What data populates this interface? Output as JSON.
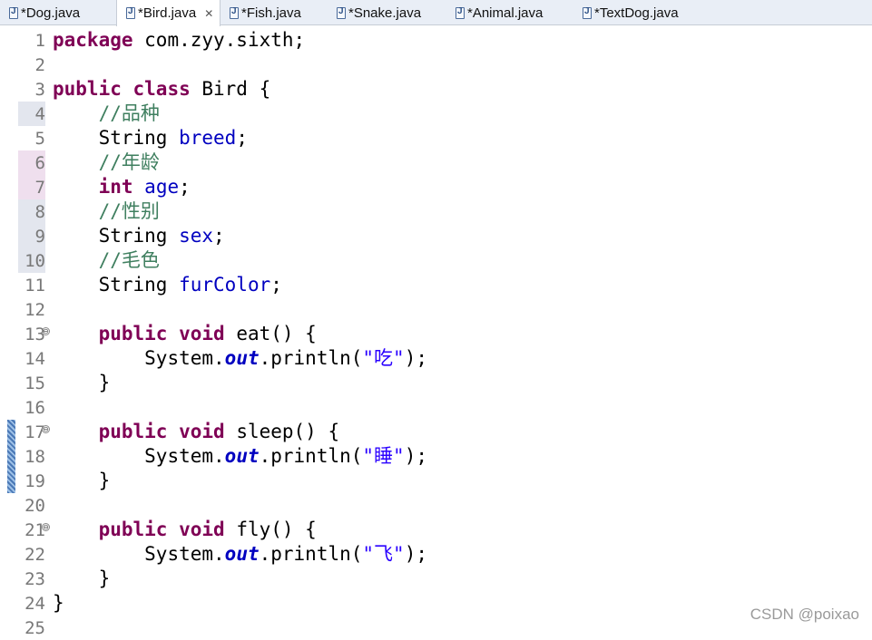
{
  "tabs": [
    {
      "label": "*Dog.java",
      "active": false
    },
    {
      "label": "*Bird.java",
      "active": true
    },
    {
      "label": "*Fish.java",
      "active": false
    },
    {
      "label": "*Snake.java",
      "active": false
    },
    {
      "label": "*Animal.java",
      "active": false
    },
    {
      "label": "*TextDog.java",
      "active": false
    }
  ],
  "close_glyph": "✕",
  "line_numbers": [
    "1",
    "2",
    "3",
    "4",
    "5",
    "6",
    "7",
    "8",
    "9",
    "10",
    "11",
    "12",
    "13",
    "14",
    "15",
    "16",
    "17",
    "18",
    "19",
    "20",
    "21",
    "22",
    "23",
    "24",
    "25"
  ],
  "fold_glyph": "⊖",
  "code": {
    "l1": {
      "kw": "package",
      "rest": " com.zyy.sixth;"
    },
    "l3": {
      "kw1": "public",
      "kw2": "class",
      "rest": " Bird {"
    },
    "l4": {
      "comment": "//品种"
    },
    "l5": {
      "type": "String",
      "field": "breed",
      "end": ";"
    },
    "l6": {
      "comment": "//年龄"
    },
    "l7": {
      "kw": "int",
      "field": "age",
      "end": ";"
    },
    "l8": {
      "comment": "//性别"
    },
    "l9": {
      "type": "String",
      "field": "sex",
      "end": ";"
    },
    "l10": {
      "comment": "//毛色"
    },
    "l11": {
      "type": "String",
      "field": "furColor",
      "end": ";"
    },
    "l13": {
      "kw1": "public",
      "kw2": "void",
      "rest": " eat() {"
    },
    "l14": {
      "pre": "System.",
      "static": "out",
      "mid": ".println(",
      "str": "\"吃\"",
      "end": ");"
    },
    "l15": {
      "text": "}"
    },
    "l17": {
      "kw1": "public",
      "kw2": "void",
      "rest": " sleep() {"
    },
    "l18": {
      "pre": "System.",
      "static": "out",
      "mid": ".println(",
      "str": "\"睡\"",
      "end": ");"
    },
    "l19": {
      "text": "}"
    },
    "l21": {
      "kw1": "public",
      "kw2": "void",
      "rest": " fly() {"
    },
    "l22": {
      "pre": "System.",
      "static": "out",
      "mid": ".println(",
      "str": "\"飞\"",
      "end": ");"
    },
    "l23": {
      "text": "}"
    },
    "l24": {
      "text": "}"
    }
  },
  "watermark": "CSDN @poixao",
  "colors": {
    "keyword": "#7f0055",
    "field": "#0000c0",
    "comment": "#3f7f5f",
    "string": "#2a00ff"
  }
}
